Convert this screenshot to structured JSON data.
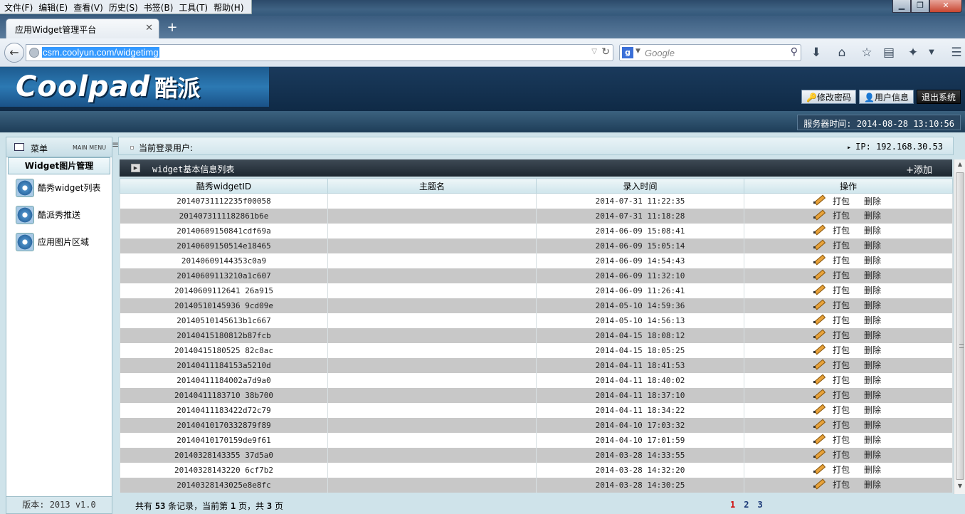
{
  "browser": {
    "menu": [
      "文件(F)",
      "编辑(E)",
      "查看(V)",
      "历史(S)",
      "书签(B)",
      "工具(T)",
      "帮助(H)"
    ],
    "tab_title": "应用Widget管理平台",
    "url": "csm.coolyun.com/widgetimg",
    "search_placeholder": "Google"
  },
  "app": {
    "logo_brand": "Coolpad",
    "logo_cn": "酷派",
    "header_buttons": [
      "修改密码",
      "用户信息",
      "退出系统"
    ],
    "server_time": "服务器时间: 2014-08-28 13:10:56"
  },
  "sidebar": {
    "title": "菜单",
    "subtitle": "MAIN MENU",
    "section": "Widget图片管理",
    "items": [
      "酷秀widget列表",
      "酷派秀推送",
      "应用图片区域"
    ],
    "version": "版本: 2013 v1.0"
  },
  "content": {
    "user_label": "当前登录用户:",
    "ip": "IP: 192.168.30.53",
    "panel_title": "widget基本信息列表",
    "add_label": "+添加",
    "columns": [
      "酷秀widgetID",
      "主题名",
      "录入时间",
      "操作"
    ],
    "op_pack": "打包",
    "op_delete": "删除",
    "rows": [
      {
        "id": "20140731112235f00058",
        "name": "",
        "time": "2014-07-31 11:22:35"
      },
      {
        "id": "2014073111182861b6e",
        "name": "",
        "time": "2014-07-31 11:18:28"
      },
      {
        "id": "20140609150841cdf69a",
        "name": "",
        "time": "2014-06-09 15:08:41"
      },
      {
        "id": "20140609150514e18465",
        "name": "",
        "time": "2014-06-09 15:05:14"
      },
      {
        "id": "20140609144353c0a9",
        "name": "",
        "time": "2014-06-09 14:54:43"
      },
      {
        "id": "20140609113210a1c607",
        "name": "",
        "time": "2014-06-09 11:32:10"
      },
      {
        "id": "20140609112641 26a915",
        "name": "",
        "time": "2014-06-09 11:26:41"
      },
      {
        "id": "20140510145936 9cd09e",
        "name": "",
        "time": "2014-05-10 14:59:36"
      },
      {
        "id": "20140510145613b1c667",
        "name": "",
        "time": "2014-05-10 14:56:13"
      },
      {
        "id": "20140415180812b87fcb",
        "name": "",
        "time": "2014-04-15 18:08:12"
      },
      {
        "id": "20140415180525 82c8ac",
        "name": "",
        "time": "2014-04-15 18:05:25"
      },
      {
        "id": "20140411184153a5210d",
        "name": "",
        "time": "2014-04-11 18:41:53"
      },
      {
        "id": "20140411184002a7d9a0",
        "name": "",
        "time": "2014-04-11 18:40:02"
      },
      {
        "id": "20140411183710 38b700",
        "name": "",
        "time": "2014-04-11 18:37:10"
      },
      {
        "id": "20140411183422d72c79",
        "name": "",
        "time": "2014-04-11 18:34:22"
      },
      {
        "id": "20140410170332879f89",
        "name": "",
        "time": "2014-04-10 17:03:32"
      },
      {
        "id": "20140410170159de9f61",
        "name": "",
        "time": "2014-04-10 17:01:59"
      },
      {
        "id": "20140328143355 37d5a0",
        "name": "",
        "time": "2014-03-28 14:33:55"
      },
      {
        "id": "20140328143220 6cf7b2",
        "name": "",
        "time": "2014-03-28 14:32:20"
      },
      {
        "id": "20140328143025e8e8fc",
        "name": "",
        "time": "2014-03-28 14:30:25"
      }
    ],
    "pager": {
      "prefix": "共有",
      "total": "53",
      "mid1": "条记录，当前第",
      "current": "1",
      "mid2": "页，共",
      "pages_total": "3",
      "suffix": "页",
      "pages": [
        "1",
        "2",
        "3"
      ]
    }
  }
}
